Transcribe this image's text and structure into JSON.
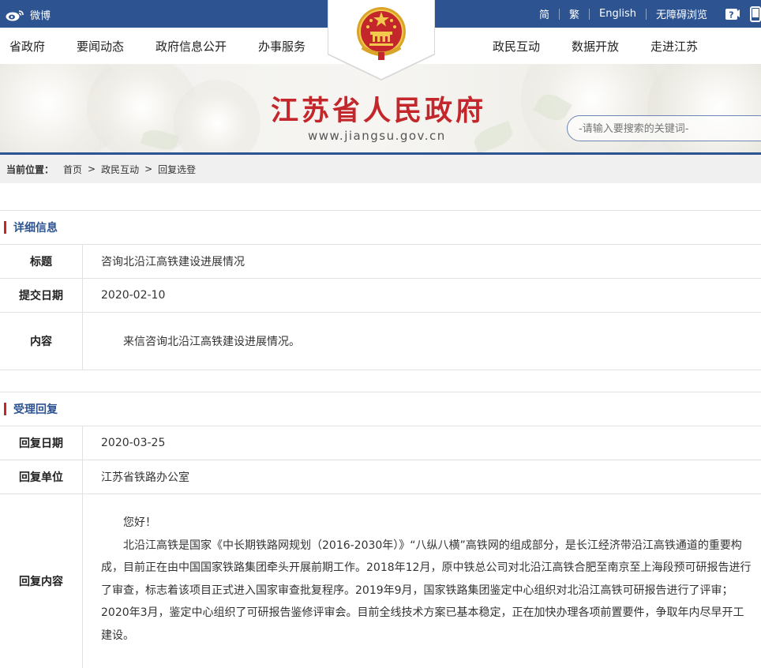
{
  "topbar": {
    "weibo": "微博",
    "links": [
      "简",
      "繁",
      "English",
      "无障碍浏览"
    ]
  },
  "nav": {
    "left": [
      "省政府",
      "要闻动态",
      "政府信息公开",
      "办事服务"
    ],
    "right": [
      "政民互动",
      "数据开放",
      "走进江苏"
    ]
  },
  "banner": {
    "title": "江苏省人民政府",
    "url": "www.jiangsu.gov.cn",
    "search_placeholder": "-请输入要搜索的关键词-"
  },
  "breadcrumb": {
    "label": "当前位置：",
    "items": [
      "首页",
      "政民互动",
      "回复选登"
    ]
  },
  "detail": {
    "heading": "详细信息",
    "title_label": "标题",
    "title_value": "咨询北沿江高铁建设进展情况",
    "date_label": "提交日期",
    "date_value": "2020-02-10",
    "content_label": "内容",
    "content_value": "来信咨询北沿江高铁建设进展情况。"
  },
  "reply": {
    "heading": "受理回复",
    "date_label": "回复日期",
    "date_value": "2020-03-25",
    "unit_label": "回复单位",
    "unit_value": "江苏省铁路办公室",
    "content_label": "回复内容",
    "greeting": "您好！",
    "body": "北沿江高铁是国家《中长期铁路网规划（2016-2030年）》“八纵八横”高铁网的组成部分，是长江经济带沿江高铁通道的重要构成，目前正在由中国国家铁路集团牵头开展前期工作。2018年12月，原中铁总公司对北沿江高铁合肥至南京至上海段预可研报告进行了审查，标志着该项目正式进入国家审查批复程序。2019年9月，国家铁路集团鉴定中心组织对北沿江高铁可研报告进行了评审；2020年3月，鉴定中心组织了可研报告鉴修评审会。目前全线技术方案已基本稳定，正在加快办理各项前置要件，争取年内尽早开工建设。"
  },
  "colors": {
    "primary_blue": "#2d5390",
    "title_red": "#c3272b"
  },
  "icons": [
    "weibo-icon",
    "help-icon",
    "phone-icon",
    "national-emblem-icon"
  ]
}
